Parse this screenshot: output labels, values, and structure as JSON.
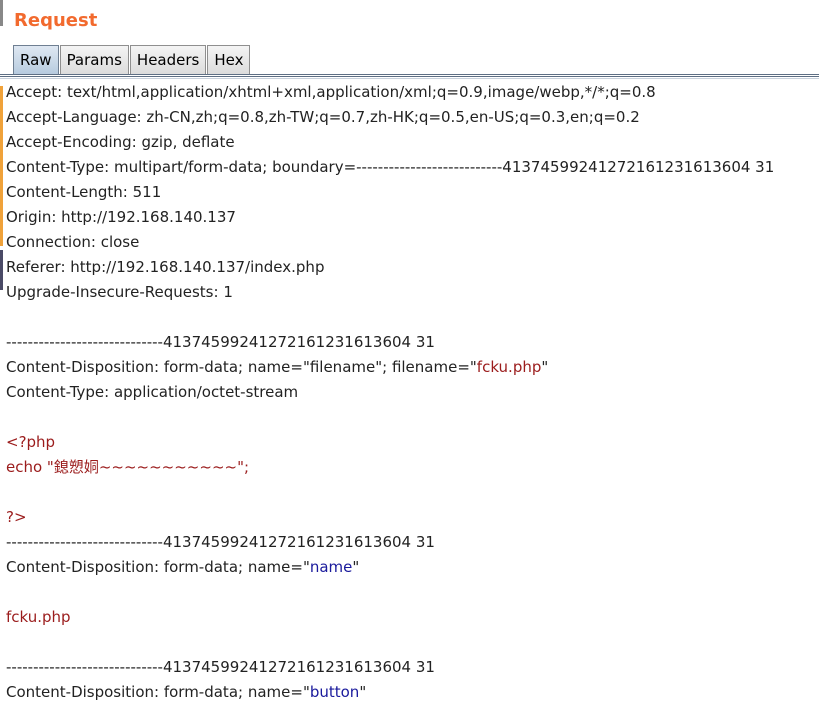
{
  "panel": {
    "title": "Request"
  },
  "tabs": [
    {
      "label": "Raw",
      "active": true
    },
    {
      "label": "Params",
      "active": false
    },
    {
      "label": "Headers",
      "active": false
    },
    {
      "label": "Hex",
      "active": false
    }
  ],
  "colors": {
    "title": "#f26a2e",
    "string_highlight": "#9b1c1c",
    "value_highlight": "#1a1a9c"
  },
  "request": {
    "accept": "Accept: text/html,application/xhtml+xml,application/xml;q=0.9,image/webp,*/*;q=0.8",
    "accept_language": "Accept-Language: zh-CN,zh;q=0.8,zh-TW;q=0.7,zh-HK;q=0.5,en-US;q=0.3,en;q=0.2",
    "accept_encoding": "Accept-Encoding: gzip, deflate",
    "content_type": "Content-Type: multipart/form-data; boundary=---------------------------41374599241272161231613604 31",
    "content_length": "Content-Length: 511",
    "origin": "Origin: http://192.168.140.137",
    "connection": "Connection: close",
    "referer": "Referer: http://192.168.140.137/index.php",
    "upgrade": "Upgrade-Insecure-Requests: 1",
    "boundary": "-----------------------------41374599241272161231613604 31",
    "part1": {
      "disposition_prefix": "Content-Disposition: form-data; name=\"filename\"; filename=\"",
      "filename": "fcku.php",
      "disposition_suffix": "\"",
      "content_type": "Content-Type: application/octet-stream",
      "code_open": "<?php",
      "code_echo_prefix": "echo \"",
      "code_echo_text": "鎴愬姛~~~~~~~~~~~",
      "code_echo_suffix": "\";",
      "code_close": "?>"
    },
    "part2": {
      "disposition_prefix": "Content-Disposition: form-data; name=\"",
      "name": "name",
      "disposition_suffix": "\"",
      "value": "fcku.php"
    },
    "part3": {
      "disposition_prefix": "Content-Disposition: form-data; name=\"",
      "name": "button",
      "disposition_suffix": "\""
    }
  }
}
